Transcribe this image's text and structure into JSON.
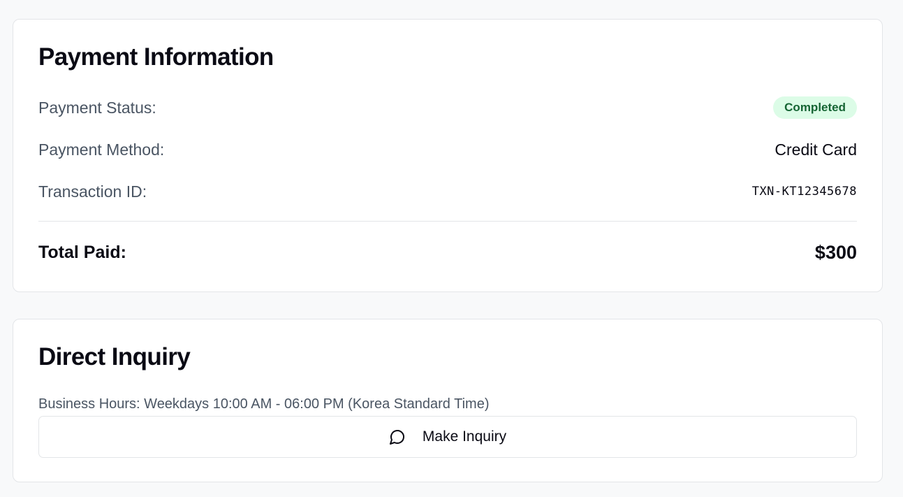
{
  "colors": {
    "page_background": "#f8f9fa",
    "card_background": "#ffffff",
    "border": "#e3e5e8",
    "label_text": "#4a5563",
    "primary_text": "#0a0a14",
    "badge_background": "#dcfce7",
    "badge_text": "#166534"
  },
  "payment": {
    "title": "Payment Information",
    "status_label": "Payment Status:",
    "status_value": "Completed",
    "method_label": "Payment Method:",
    "method_value": "Credit Card",
    "transaction_label": "Transaction ID:",
    "transaction_value": "TXN-KT12345678",
    "total_label": "Total Paid:",
    "total_value": "$300"
  },
  "inquiry": {
    "title": "Direct Inquiry",
    "business_hours": "Business Hours: Weekdays 10:00 AM - 06:00 PM (Korea Standard Time)",
    "button_label": "Make Inquiry",
    "button_icon": "message-circle-icon"
  }
}
